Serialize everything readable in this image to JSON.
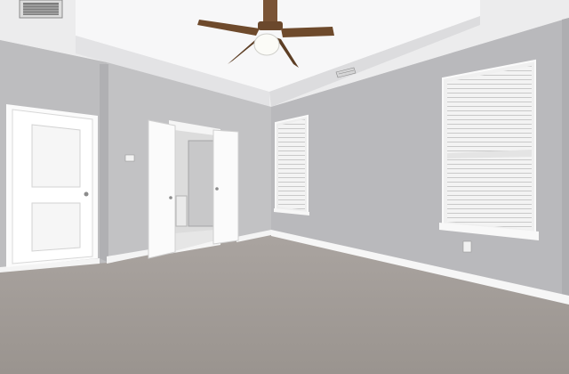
{
  "scene": {
    "room": "empty-bedroom",
    "colors": {
      "wall_light": "#c4c4c6",
      "wall_dark": "#b4b4b6",
      "ceiling": "#eeeeef",
      "tray": "#f6f6f7",
      "carpet": "#a49e9a",
      "trim": "#fafafa",
      "fan_blade": "#6e4a2c"
    },
    "objects": [
      "ceiling-fan",
      "entry-door",
      "double-doors-to-bathroom",
      "window-left",
      "window-right",
      "ceiling-vent",
      "hvac-vent",
      "light-switch",
      "wall-outlet",
      "carpet-floor"
    ]
  }
}
